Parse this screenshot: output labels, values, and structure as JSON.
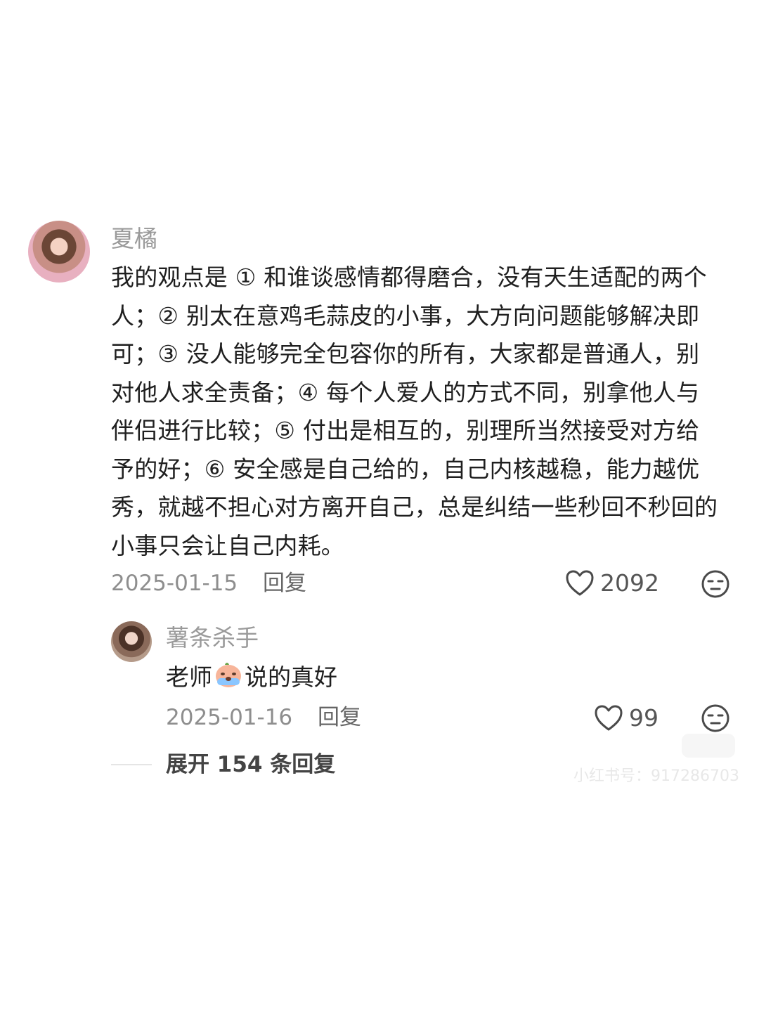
{
  "main_comment": {
    "username": "夏橘",
    "text": "我的观点是 ① 和谁谈感情都得磨合，没有天生适配的两个人；② 别太在意鸡毛蒜皮的小事，大方向问题能够解决即可；③ 没人能够完全包容你的所有，大家都是普通人，别对他人求全责备；④ 每个人爱人的方式不同，别拿他人与伴侣进行比较；⑤ 付出是相互的，别理所当然接受对方给予的好；⑥ 安全感是自己给的，自己内核越稳，能力越优秀，就越不担心对方离开自己，总是纠结一些秒回不秒回的小事只会让自己内耗。",
    "date": "2025-01-15",
    "reply_label": "回复",
    "likes": "2092",
    "icons": {
      "avatar": "user-avatar",
      "like": "heart-icon",
      "dislike": "neutral-face-icon"
    }
  },
  "reply_comment": {
    "username": "薯条杀手",
    "text_before": "老师",
    "text_after": "说的真好",
    "emoji": "crying-peach-emoji",
    "date": "2025-01-16",
    "reply_label": "回复",
    "likes": "99",
    "icons": {
      "avatar": "user-avatar",
      "like": "heart-icon",
      "dislike": "neutral-face-icon"
    }
  },
  "expand": {
    "label": "展开 154 条回复"
  },
  "watermark": {
    "text": "小红书号：917286703"
  }
}
